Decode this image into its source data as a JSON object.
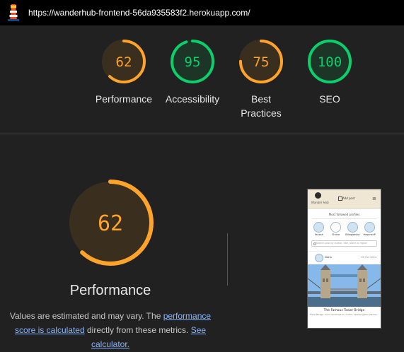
{
  "topbar": {
    "url": "https://wanderhub-frontend-56da935583f2.herokuapp.com/",
    "logo_icon": "lighthouse-icon"
  },
  "scores": [
    {
      "label": "Performance",
      "value": "62",
      "color": "#ffa32b"
    },
    {
      "label": "Accessibility",
      "value": "95",
      "color": "#0cce6b"
    },
    {
      "label": "Best Practices",
      "value": "75",
      "color": "#ffa32b"
    },
    {
      "label": "SEO",
      "value": "100",
      "color": "#0cce6b"
    }
  ],
  "main": {
    "score": "62",
    "title": "Performance",
    "desc_prefix": "Values are estimated and may vary. The ",
    "desc_link1": "performance score is calculated",
    "desc_mid": " directly from these metrics. ",
    "desc_link2": "See calculator.",
    "accent": "#ffa32b"
  },
  "screenshot": {
    "logo_text": "Wander Hub",
    "add_post": "Add post",
    "most_followed": "Most followed profiles",
    "users": [
      "Yeyash",
      "Shrisa",
      "Billagoosha",
      "HeyanshP"
    ],
    "search_placeholder": "Search post by author, title, place or region",
    "post_author": "Nisha",
    "post_date": "09 Oct 2024",
    "post_title": "The Famous Tower Bridge",
    "post_text": "Tower Bridge, iconic landmark in London, spanning the Thames..."
  }
}
